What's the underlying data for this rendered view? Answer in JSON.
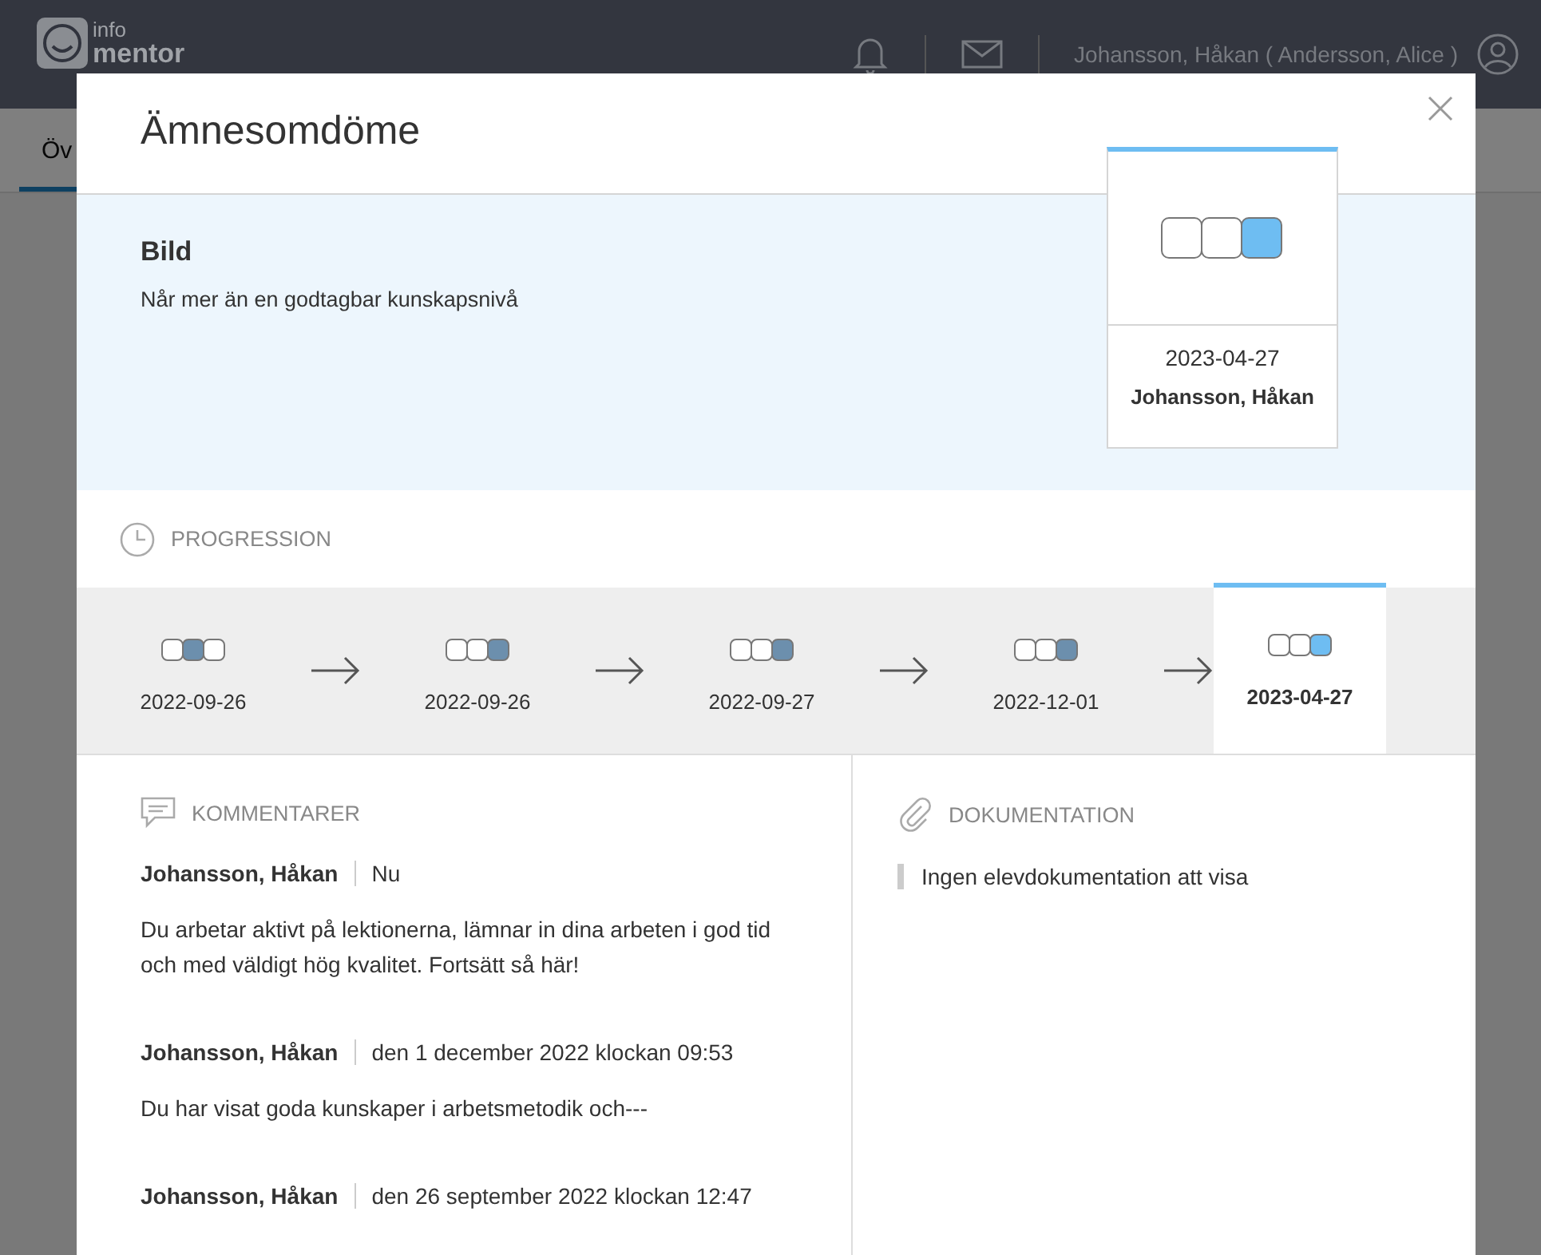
{
  "header": {
    "logo_top": "info",
    "logo_bottom": "mentor",
    "user": "Johansson, Håkan ( Andersson, Alice )"
  },
  "page_tabs": [
    {
      "label": "Öv",
      "selected": true
    }
  ],
  "modal": {
    "title": "Ämnesomdöme",
    "subject": "Bild",
    "assessment": "Når mer än en godtagbar kunskapsnivå",
    "card": {
      "boxes": [
        {
          "filled": false
        },
        {
          "filled": false
        },
        {
          "filled": true
        }
      ],
      "date": "2023-04-27",
      "author": "Johansson, Håkan"
    },
    "progression_title": "PROGRESSION",
    "steps": [
      {
        "date": "2022-09-26",
        "selected": false,
        "boxes": [
          {
            "filled": false
          },
          {
            "filled": true
          },
          {
            "filled": false
          }
        ]
      },
      {
        "date": "2022-09-26",
        "selected": false,
        "boxes": [
          {
            "filled": false
          },
          {
            "filled": false
          },
          {
            "filled": true
          }
        ]
      },
      {
        "date": "2022-09-27",
        "selected": false,
        "boxes": [
          {
            "filled": false
          },
          {
            "filled": false
          },
          {
            "filled": true
          }
        ]
      },
      {
        "date": "2022-12-01",
        "selected": false,
        "boxes": [
          {
            "filled": false
          },
          {
            "filled": false
          },
          {
            "filled": true
          }
        ]
      },
      {
        "date": "2023-04-27",
        "selected": true,
        "boxes": [
          {
            "filled": false
          },
          {
            "filled": false
          },
          {
            "filled": true
          }
        ]
      }
    ],
    "comments_title": "KOMMENTARER",
    "comments": [
      {
        "author": "Johansson, Håkan",
        "when": "Nu",
        "text": "Du arbetar aktivt på lektionerna, lämnar in dina arbeten i god tid och med väldigt hög kvalitet. Fortsätt så här!"
      },
      {
        "author": "Johansson, Håkan",
        "when": "den 1 december 2022 klockan 09:53",
        "text": "Du har visat goda kunskaper i arbetsmetodik och---"
      },
      {
        "author": "Johansson, Håkan",
        "when": "den 26 september 2022 klockan 12:47"
      }
    ],
    "documentation_title": "DOKUMENTATION",
    "documentation_empty": "Ingen elevdokumentation att visa"
  }
}
